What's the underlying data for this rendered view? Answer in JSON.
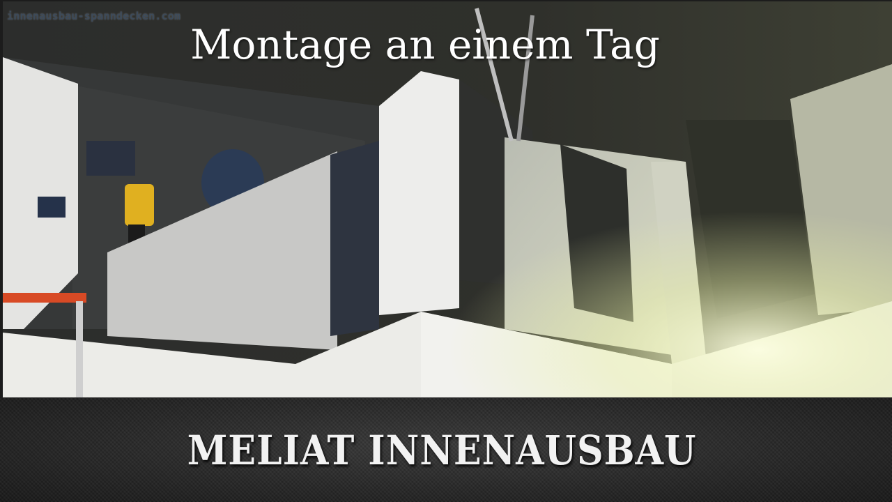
{
  "watermark": "innenausbau-spanndecken.com",
  "title": "Montage an einem Tag",
  "brand": "MELIAT INNENAUSBAU",
  "colors": {
    "ceiling": "#2b2c2a",
    "drywall": "#e6e6e4",
    "led_glow": "#f3f6c0",
    "footer_bg": "#262626",
    "text": "#ffffff"
  }
}
